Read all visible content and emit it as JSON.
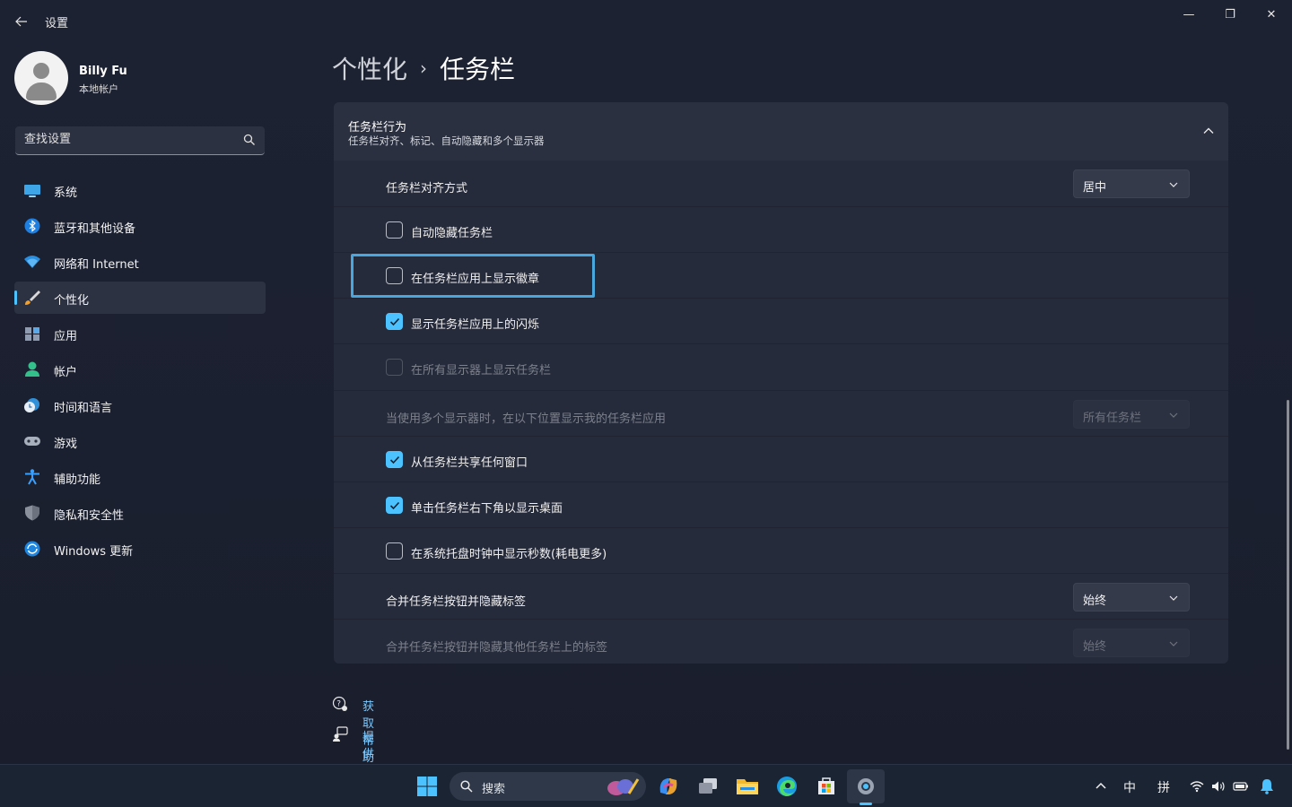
{
  "window": {
    "title": "设置",
    "minimize": "—",
    "maximize": "❐",
    "close": "✕"
  },
  "profile": {
    "name": "Billy Fu",
    "account_type": "本地帐户"
  },
  "search": {
    "placeholder": "查找设置"
  },
  "nav": {
    "items": [
      {
        "label": "系统",
        "icon": "system-icon"
      },
      {
        "label": "蓝牙和其他设备",
        "icon": "bluetooth-icon"
      },
      {
        "label": "网络和 Internet",
        "icon": "wifi-icon"
      },
      {
        "label": "个性化",
        "icon": "brush-icon",
        "active": true
      },
      {
        "label": "应用",
        "icon": "apps-icon"
      },
      {
        "label": "帐户",
        "icon": "account-icon"
      },
      {
        "label": "时间和语言",
        "icon": "clock-globe-icon"
      },
      {
        "label": "游戏",
        "icon": "gamepad-icon"
      },
      {
        "label": "辅助功能",
        "icon": "accessibility-icon"
      },
      {
        "label": "隐私和安全性",
        "icon": "shield-icon"
      },
      {
        "label": "Windows 更新",
        "icon": "update-icon"
      }
    ]
  },
  "breadcrumb": {
    "parent": "个性化",
    "separator": "›",
    "current": "任务栏"
  },
  "section": {
    "title": "任务栏行为",
    "subtitle": "任务栏对齐、标记、自动隐藏和多个显示器"
  },
  "settings": {
    "alignment": {
      "label": "任务栏对齐方式",
      "value": "居中"
    },
    "auto_hide": {
      "label": "自动隐藏任务栏",
      "checked": false
    },
    "badges": {
      "label": "在任务栏应用上显示徽章",
      "checked": false
    },
    "flashing": {
      "label": "显示任务栏应用上的闪烁",
      "checked": true
    },
    "all_displays": {
      "label": "在所有显示器上显示任务栏",
      "checked": false,
      "disabled": true
    },
    "multi_display": {
      "label": "当使用多个显示器时，在以下位置显示我的任务栏应用",
      "value": "所有任务栏",
      "disabled": true
    },
    "share_window": {
      "label": "从任务栏共享任何窗口",
      "checked": true
    },
    "show_desktop": {
      "label": "单击任务栏右下角以显示桌面",
      "checked": true
    },
    "show_seconds": {
      "label": "在系统托盘时钟中显示秒数(耗电更多)",
      "checked": false
    },
    "combine": {
      "label": "合并任务栏按钮并隐藏标签",
      "value": "始终"
    },
    "combine_other": {
      "label": "合并任务栏按钮并隐藏其他任务栏上的标签",
      "value": "始终",
      "disabled": true
    }
  },
  "links": {
    "help": "获取帮助",
    "feedback": "提供反馈"
  },
  "taskbar": {
    "search_label": "搜索",
    "ime_mode": "中",
    "ime_layout": "拼"
  },
  "colors": {
    "accent": "#4cc2ff",
    "focus": "#4aa7dd",
    "link": "#79c8ff"
  }
}
